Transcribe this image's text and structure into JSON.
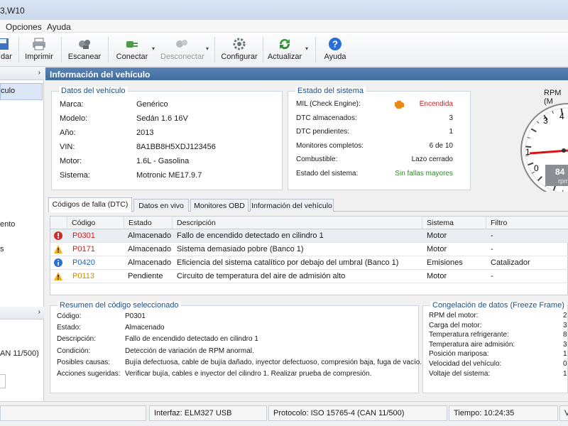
{
  "window": {
    "title": "3,W10"
  },
  "menu": {
    "opciones": "Opciones",
    "ayuda": "Ayuda"
  },
  "toolbar": {
    "guardar": "dar",
    "imprimir": "Imprimir",
    "escanear": "Escanear",
    "conectar": "Conectar",
    "desconectar": "Desconectar",
    "configurar": "Configurar",
    "actualizar": "Actualizar",
    "ayuda": "Ayuda"
  },
  "left_panel": {
    "expand1": "›",
    "item_vehiculo": "culo",
    "item_mantenimiento": "ento",
    "item_s": "s",
    "expand2": "›",
    "protocol_snip": "AN 11/500)"
  },
  "main": {
    "header": "Información del vehículo"
  },
  "vehicle": {
    "title": "Datos del vehículo",
    "rows": [
      {
        "label": "Marca:",
        "value": "Genérico"
      },
      {
        "label": "Modelo:",
        "value": "Sedán 1.6 16V"
      },
      {
        "label": "Año:",
        "value": "2013"
      },
      {
        "label": "VIN:",
        "value": "8A1BB8H5XDJ123456"
      },
      {
        "label": "Motor:",
        "value": "1.6L - Gasolina"
      },
      {
        "label": "Sistema:",
        "value": "Motronic ME17.9.7"
      }
    ]
  },
  "system": {
    "title": "Estado del sistema",
    "rows": [
      {
        "label": "MIL (Check Engine):",
        "value": "Encendida"
      },
      {
        "label": "DTC almacenados:",
        "value": "3"
      },
      {
        "label": "DTC pendientes:",
        "value": "1"
      },
      {
        "label": "Monitores completos:",
        "value": "6 de 10"
      },
      {
        "label": "Combustible:",
        "value": "Lazo cerrado"
      },
      {
        "label": "Estado del sistema:",
        "value": "Sin fallas mayores"
      }
    ],
    "colors": {
      "on": "#d01f1f",
      "ok": "#2a8a25"
    }
  },
  "gauge": {
    "title": "RPM (M",
    "ticks": [
      "0",
      "1",
      "3",
      "4"
    ],
    "readout": "84",
    "unit": "rpm",
    "level": 0.84
  },
  "tabs": [
    {
      "label": "Códigos de falla (DTC)",
      "active": true
    },
    {
      "label": "Datos en vivo"
    },
    {
      "label": "Monitores OBD"
    },
    {
      "label": "Información del vehículo"
    }
  ],
  "dtc_table": {
    "headers": [
      "Código",
      "Estado",
      "Descripción",
      "Sistema",
      "Filtro"
    ],
    "rows": [
      {
        "icon": "error-icon",
        "code": "P0301",
        "estado": "Almacenado",
        "desc": "Fallo de encendido detectado en cilindro 1",
        "sistema": "Motor",
        "filtro": "-"
      },
      {
        "icon": "warning-icon",
        "code": "P0171",
        "estado": "Almacenado",
        "desc": "Sistema demasiado pobre (Banco 1)",
        "sistema": "Motor",
        "filtro": "-"
      },
      {
        "icon": "info-icon",
        "code": "P0420",
        "estado": "Almacenado",
        "desc": "Eficiencia del sistema catalítico por debajo del umbral (Banco 1)",
        "sistema": "Emisiones",
        "filtro": "Catalizador"
      },
      {
        "icon": "warning-icon",
        "code": "P0113",
        "estado": "Pendiente",
        "desc": "Circuito de temperatura del aire de admisión alto",
        "sistema": "Motor",
        "filtro": "-"
      }
    ]
  },
  "summary": {
    "title": "Resumen del código seleccionado",
    "rows": [
      {
        "label": "Código:",
        "value": "P0301"
      },
      {
        "label": "Estado:",
        "value": "Almacenado"
      },
      {
        "label": "Descripción:",
        "value": "Fallo de encendido detectado en cilindro 1"
      },
      {
        "label": "Condición:",
        "value": "Detección de variación de RPM anormal."
      },
      {
        "label": "Posibles causas:",
        "value": "Bujía defectuosa, cable de bujía dañado, inyector defectuoso, compresión baja, fuga de vacío."
      },
      {
        "label": "Acciones sugeridas:",
        "value": "Verificar bujía, cables e inyector del cilindro 1. Realizar prueba de compresión."
      }
    ]
  },
  "freeze": {
    "title": "Congelación de datos (Freeze Frame)",
    "rows": [
      {
        "label": "RPM del motor:",
        "value": "2"
      },
      {
        "label": "Carga del motor:",
        "value": "3"
      },
      {
        "label": "Temperatura refrigerante:",
        "value": "8"
      },
      {
        "label": "Temperatura aire admisión:",
        "value": "3"
      },
      {
        "label": "Posición mariposa:",
        "value": "1"
      },
      {
        "label": "Velocidad del vehículo:",
        "value": "0"
      },
      {
        "label": "Voltaje del sistema:",
        "value": "1"
      }
    ]
  },
  "status": {
    "interfaz": "Interfaz:  ELM327 USB",
    "protocolo": "Protocolo:  ISO 15765-4 (CAN 11/500)",
    "tiempo": "Tiempo:  10:24:35",
    "v": "V"
  }
}
